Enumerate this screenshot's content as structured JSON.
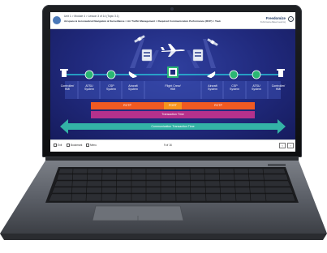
{
  "app": {
    "title": "Unit 1 > Module 4 > Lesson 3 of 14 (Topic 3.1)",
    "subtitle": "Airspace & Aeronautical Navigation & Surveillance > Air Traffic Management > Required Communication Performance (RCP) > Task",
    "brand": "Freedomize",
    "brand_sub": "Performance-Based Learning",
    "help_label": "?"
  },
  "diagram": {
    "nodes": [
      {
        "label": "Controller/\nHMI",
        "icon": "controller-workstation-icon"
      },
      {
        "label": "ATSU\nSystem",
        "icon": "satellite-dish-icon"
      },
      {
        "label": "CSP\nSystem",
        "icon": "satellite-dish-icon"
      },
      {
        "label": "Aircraft\nSystem",
        "icon": "satellite-dish-icon"
      },
      {
        "label": "Flight Crew/\nHMI",
        "icon": "avionics-display-icon"
      },
      {
        "label": "Aircraft\nSystem",
        "icon": "satellite-dish-icon"
      },
      {
        "label": "CSP\nSystem",
        "icon": "satellite-dish-icon"
      },
      {
        "label": "ATSU\nSystem",
        "icon": "satellite-dish-icon"
      },
      {
        "label": "Controller/\nHMI",
        "icon": "controller-workstation-icon"
      }
    ],
    "segments": [
      {
        "label": "RCTP",
        "color": "#f05a22"
      },
      {
        "label": "PORT",
        "color": "#f7941d"
      },
      {
        "label": "RCTP",
        "color": "#f05a22"
      }
    ],
    "transaction_time": {
      "label": "Transaction Time",
      "color": "#b5318c"
    },
    "communication_time": {
      "label": "Communication Transaction Time",
      "color": "#33b3a6"
    }
  },
  "footer": {
    "items": [
      "Exit",
      "Bookmark",
      "Menu"
    ],
    "page": "9 of 16",
    "prev": "‹",
    "next": "›"
  },
  "colors": {
    "screen_bg": "#20297c",
    "connector": "#27c3d9",
    "node_circle": "#2bb673"
  }
}
